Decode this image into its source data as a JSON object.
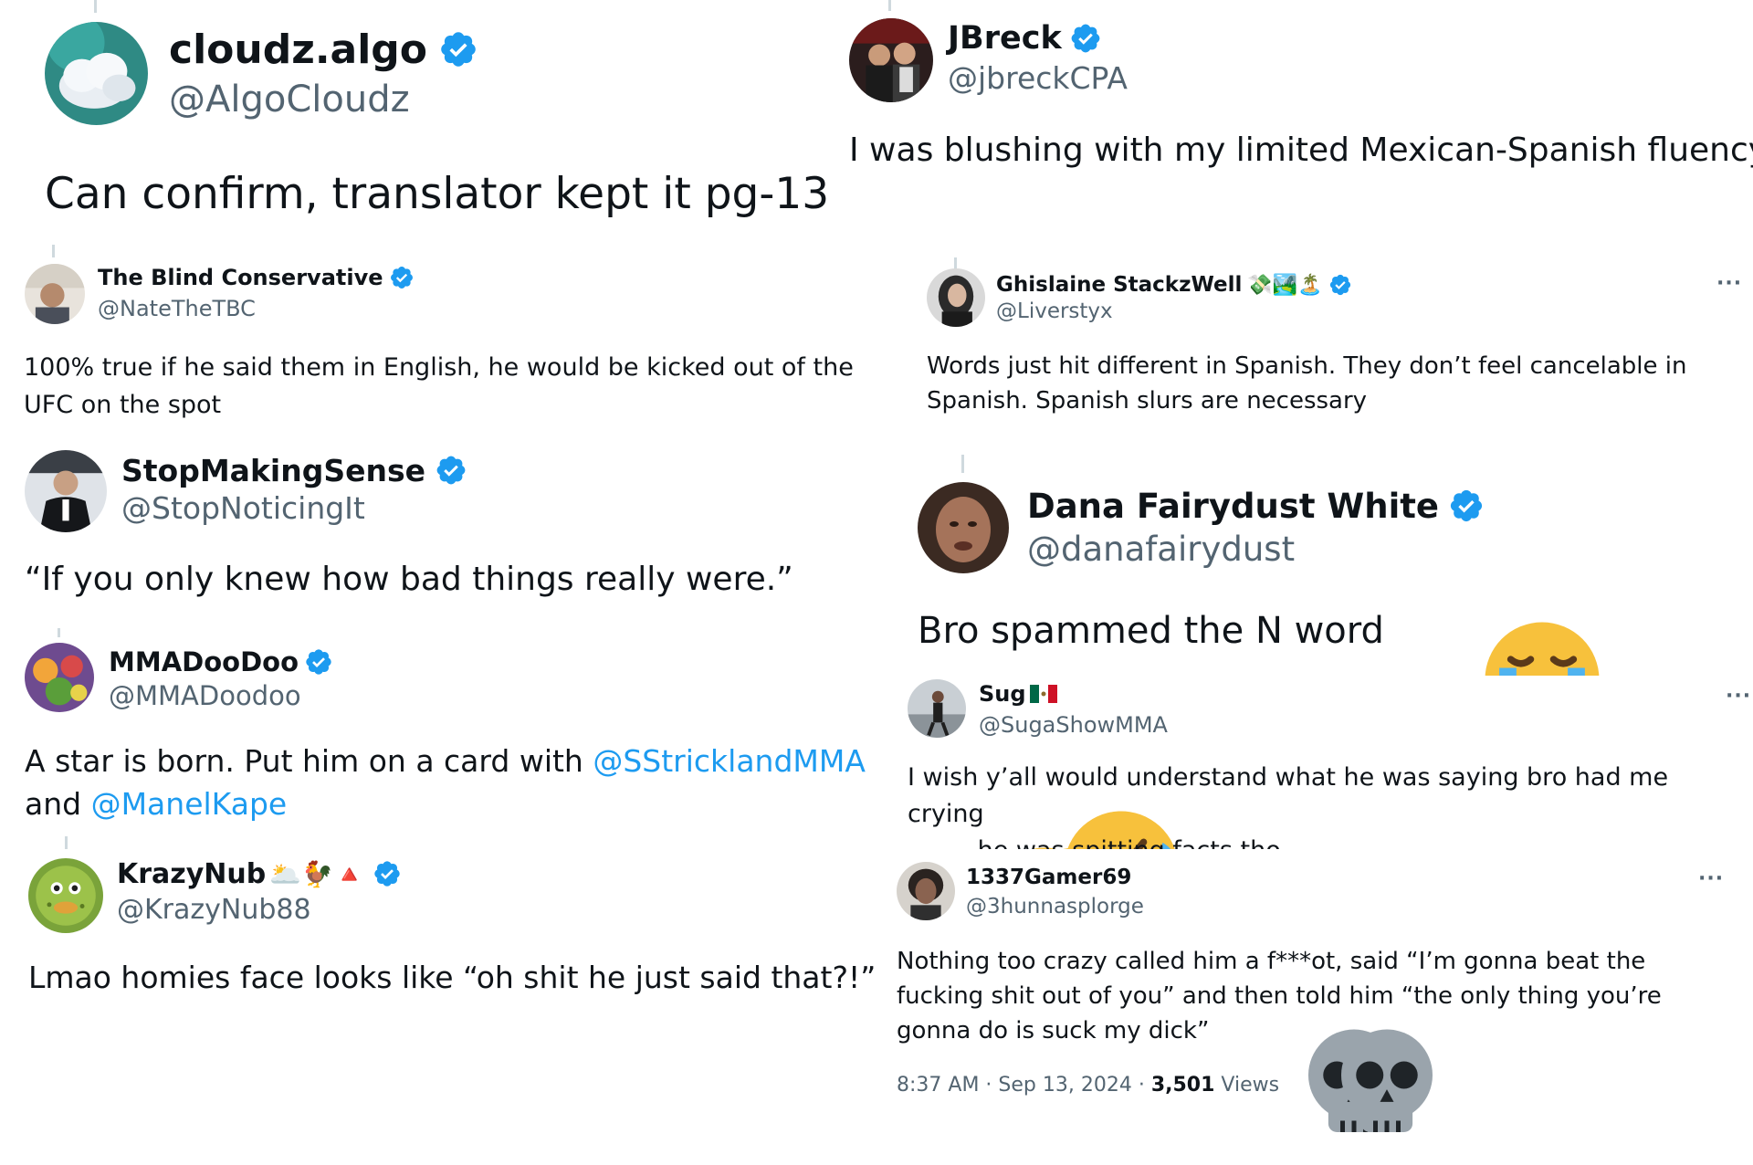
{
  "tweets": [
    {
      "name": "cloudz.algo",
      "handle": "@AlgoCloudz",
      "text": "Can confirm, translator kept it pg-13"
    },
    {
      "name": "JBreck",
      "handle": "@jbreckCPA",
      "text": "I was blushing with my limited Mexican-Spanish fluency."
    },
    {
      "name": "The Blind Conservative",
      "handle": "@NateTheTBC",
      "text": "100% true if he said them in English, he would be kicked out of the UFC on the spot"
    },
    {
      "name": "Ghislaine StackzWell",
      "name_emoji": "💸🏞️🏝️",
      "handle": "@Liverstyx",
      "text": "Words just hit different in Spanish. They don’t feel cancelable in Spanish. Spanish slurs are necessary",
      "more": "···"
    },
    {
      "name": "StopMakingSense",
      "handle": "@StopNoticingIt",
      "text": "“If you only knew how bad things really were.”"
    },
    {
      "name": "Dana Fairydust White",
      "handle": "@danafairydust",
      "text": "Bro spammed the N word",
      "text_emoji": "😭"
    },
    {
      "name": "MMADooDoo",
      "handle": "@MMADoodoo",
      "text_before": "A star is born. Put him on a card with ",
      "mention1": "@SStricklandMMA",
      "text_middle": " and ",
      "mention2": "@ManelKape"
    },
    {
      "name": "Sug",
      "name_emoji": "🇲🇽",
      "handle": "@SugaShowMMA",
      "text_a": "I wish y’all would understand what he was saying bro had me crying",
      "text_b": " he was spitting facts tho",
      "more": "···"
    },
    {
      "name": "KrazyNub",
      "name_emoji": "🌥️🐓🔺",
      "handle": "@KrazyNub88",
      "text": "Lmao homies face looks like “oh shit he just said that?!”"
    },
    {
      "name": "1337Gamer69",
      "handle": "@3hunnasplorge",
      "text": "Nothing too crazy called him a f***ot, said “I’m gonna beat the fucking shit out of you” and then told him “the only thing you’re gonna do is suck my dick”",
      "more": "···",
      "meta_time": "8:37 AM · Sep 13, 2024 · ",
      "meta_views": "3,501",
      "meta_views_label": " Views"
    }
  ],
  "colors": {
    "verified": "#1d9bf0",
    "text": "#0f1419",
    "secondary": "#536471",
    "mention": "#1d9bf0",
    "thread": "#cfd9de"
  },
  "icons": {
    "verified": "verified-badge-icon",
    "more": "more-options-icon",
    "skull": "skull-emoji-icon",
    "laugh": "rolling-laughing-emoji-icon",
    "cry": "loudly-crying-emoji-icon"
  }
}
